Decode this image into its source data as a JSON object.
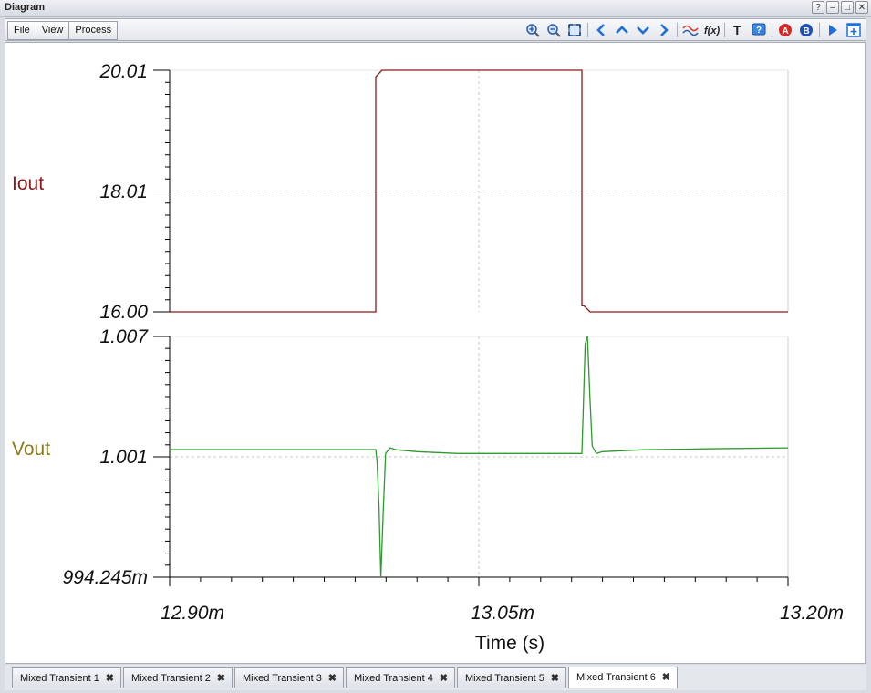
{
  "window": {
    "title": "Diagram"
  },
  "window_buttons": [
    {
      "name": "help-icon",
      "glyph": "?"
    },
    {
      "name": "minimize-icon",
      "glyph": "–"
    },
    {
      "name": "maximize-icon",
      "glyph": "□"
    },
    {
      "name": "close-icon",
      "glyph": "✕"
    }
  ],
  "menu": {
    "file": "File",
    "view": "View",
    "process": "Process"
  },
  "toolbar_icons": [
    "zoom-in-icon",
    "zoom-out-icon",
    "fit-to-window-icon",
    "cursor-left-icon",
    "cursor-up-icon",
    "cursor-down-icon",
    "cursor-right-icon",
    "curve-style-icon",
    "function-icon",
    "text-tool-icon",
    "help-tool-icon",
    "cursor-a-icon",
    "cursor-b-icon",
    "play-icon",
    "new-diagram-icon"
  ],
  "colors": {
    "iout": "#8b1a1a",
    "vout": "#2e9a2e",
    "iout_label": "#8b1a1a",
    "vout_label": "#8a7a1a",
    "grid": "#c8c8c8"
  },
  "chart_data": {
    "type": "line",
    "xlabel": "Time (s)",
    "x_ticks": [
      "12.90m",
      "13.05m",
      "13.20m"
    ],
    "xlim": [
      12.9,
      13.2
    ],
    "x_unit": "ms",
    "panels": [
      {
        "name": "Iout",
        "y_ticks": [
          "20.01",
          "18.01",
          "16.00"
        ],
        "ylim": [
          16.0,
          20.01
        ],
        "series": {
          "name": "Iout",
          "x": [
            12.9,
            13.0,
            13.0,
            13.003,
            13.1,
            13.1,
            13.101,
            13.104,
            13.2
          ],
          "y": [
            16.0,
            16.0,
            19.9,
            20.01,
            20.01,
            16.1,
            16.1,
            16.0,
            16.0
          ]
        }
      },
      {
        "name": "Vout",
        "y_ticks": [
          "1.007",
          "1.001",
          "994.245m"
        ],
        "ylim": [
          0.994245,
          1.007
        ],
        "series": {
          "name": "Vout",
          "x": [
            12.9,
            13.0,
            13.0006,
            13.0016,
            13.0025,
            13.0036,
            13.0048,
            13.007,
            13.01,
            13.02,
            13.04,
            13.06,
            13.09,
            13.1,
            13.1006,
            13.1016,
            13.1027,
            13.1038,
            13.105,
            13.107,
            13.11,
            13.13,
            13.16,
            13.2
          ],
          "y": [
            1.00101,
            1.00101,
            1.0004,
            0.998,
            0.994245,
            0.9976,
            1.0008,
            1.0011,
            1.001,
            1.0009,
            1.0008,
            1.0008,
            1.0008,
            1.0008,
            1.003,
            1.0066,
            1.007,
            1.004,
            1.0012,
            1.0008,
            1.0009,
            1.001,
            1.00105,
            1.0011
          ]
        }
      }
    ],
    "grid": true
  },
  "tabs": [
    {
      "label": "Mixed Transient 1",
      "active": false
    },
    {
      "label": "Mixed Transient 2",
      "active": false
    },
    {
      "label": "Mixed Transient 3",
      "active": false
    },
    {
      "label": "Mixed Transient 4",
      "active": false
    },
    {
      "label": "Mixed Transient 5",
      "active": false
    },
    {
      "label": "Mixed Transient 6",
      "active": true
    }
  ]
}
